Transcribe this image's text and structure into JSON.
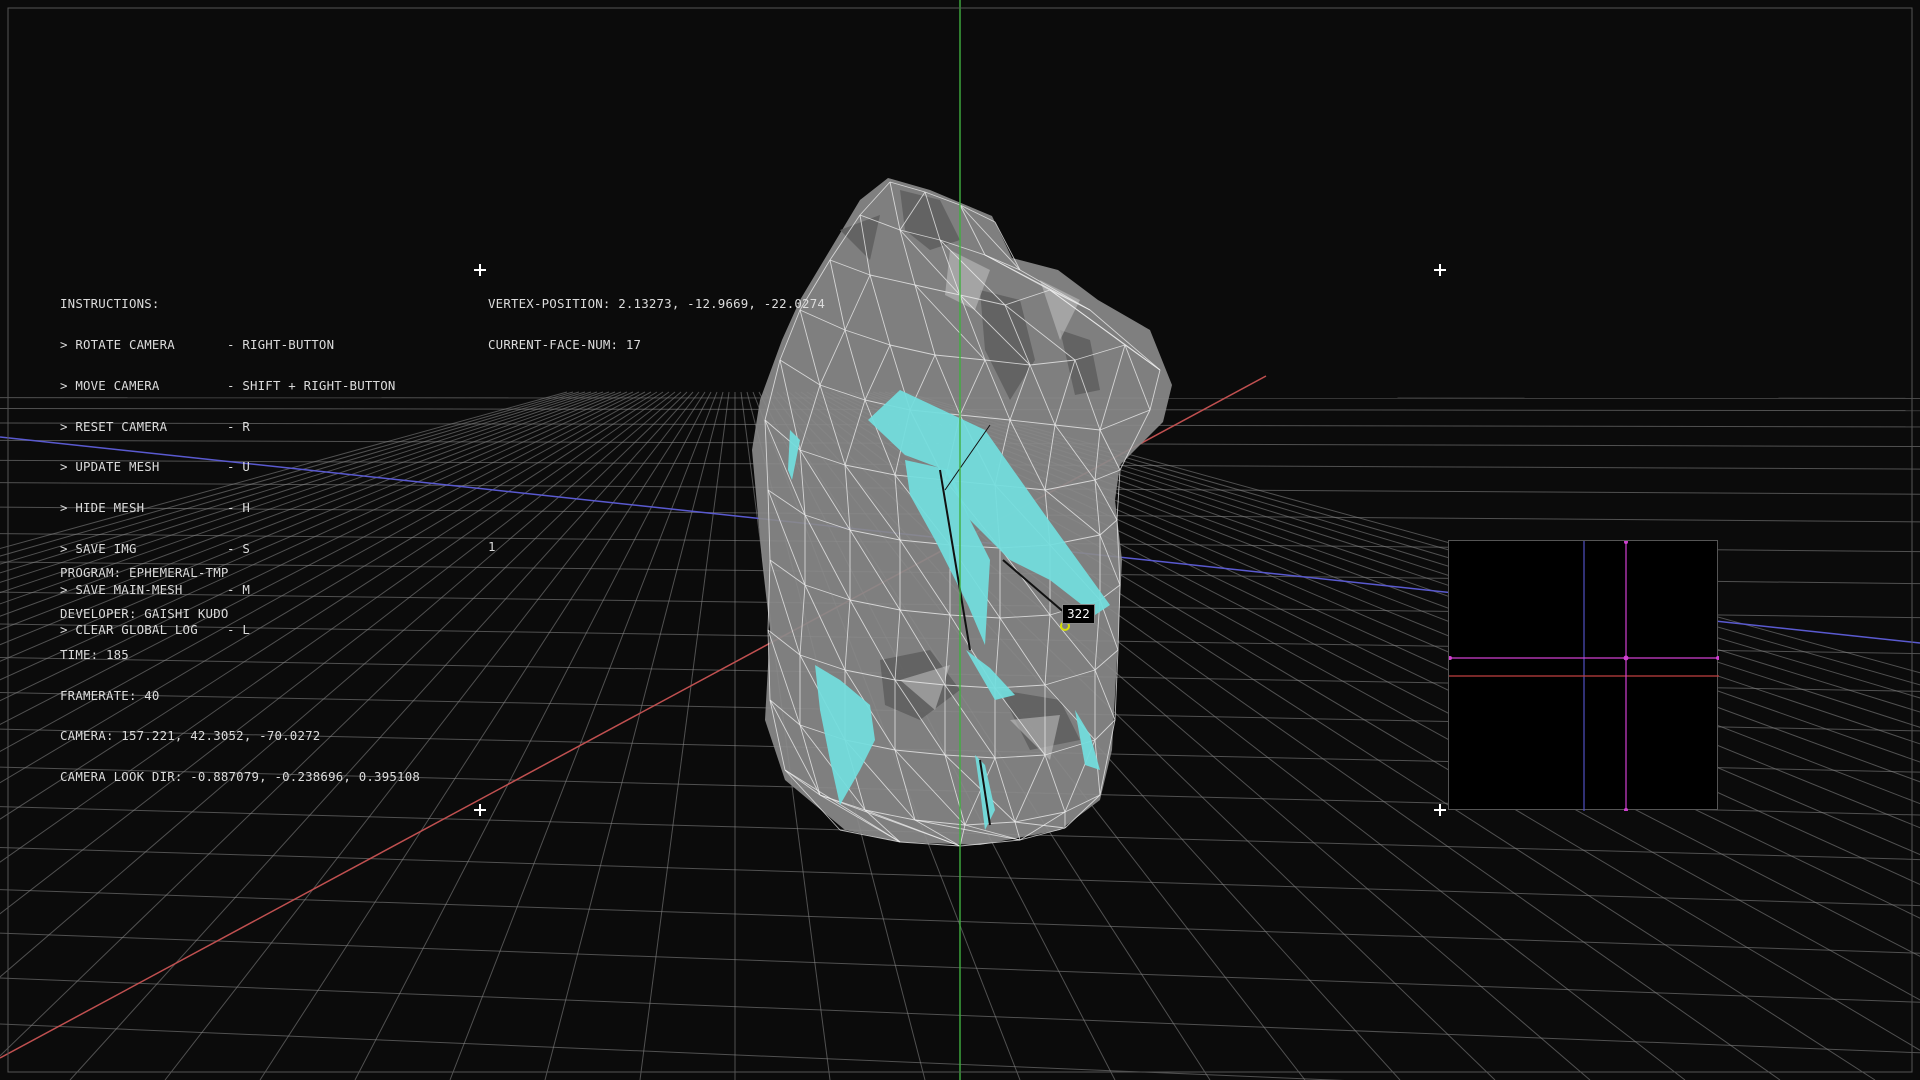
{
  "instructions": {
    "heading": "INSTRUCTIONS:",
    "items": [
      {
        "action": "> ROTATE CAMERA",
        "key": "- RIGHT-BUTTON"
      },
      {
        "action": "> MOVE CAMERA",
        "key": "- SHIFT + RIGHT-BUTTON"
      },
      {
        "action": "> RESET CAMERA",
        "key": "- R"
      },
      {
        "action": "> UPDATE MESH",
        "key": "- U"
      },
      {
        "action": "> HIDE MESH",
        "key": "- H"
      },
      {
        "action": "> SAVE IMG",
        "key": "- S"
      },
      {
        "action": "> SAVE MAIN-MESH",
        "key": "- M"
      },
      {
        "action": "> CLEAR GLOBAL LOG",
        "key": "- L"
      }
    ]
  },
  "vertex_info": {
    "position": "VERTEX-POSITION: 2.13273, -12.9669, -22.0274",
    "face_num": "CURRENT-FACE-NUM: 17"
  },
  "program_info": {
    "program": "PROGRAM: EPHEMERAL-TMP",
    "developer": "DEVELOPER: GAISHI KUDO",
    "time": "TIME: 185",
    "framerate": "FRAMERATE: 40",
    "camera": "CAMERA: 157.221, 42.3052, -70.0272",
    "look_dir": "CAMERA LOOK DIR: -0.887079, -0.238696, 0.395108"
  },
  "marker_number": "1",
  "vertex_label": "322",
  "colors": {
    "background": "#0b0b0b",
    "grid": "#8a8a8a",
    "x_axis": "#c05050",
    "z_axis": "#5050c0",
    "y_axis": "#40b040",
    "mesh_fill": "#8c8c8c",
    "mesh_wire": "#f0f0f0",
    "highlight_faces": "#6fd8d8",
    "minimap_crosshair": "#d040d0"
  }
}
